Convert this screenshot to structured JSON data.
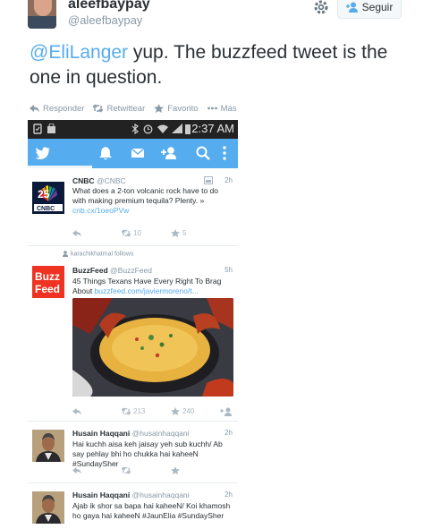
{
  "profile": {
    "name": "aleefbaypay",
    "handle": "@aleefbaypay",
    "follow_label": "Seguir"
  },
  "tweet": {
    "mention": "@EliLanger",
    "text": " yup. The buzzfeed tweet is the one in question."
  },
  "actions": {
    "reply": "Responder",
    "retweet": "Retwittear",
    "favorite": "Favorito",
    "more": "Más"
  },
  "phone": {
    "time": "2:37 AM",
    "feed": [
      {
        "name": "CNBC",
        "handle": "@CNBC",
        "time": "2h",
        "text": "What does a 2-ton volcanic rock have to do with making premium tequila? Plenty. » ",
        "link": "cnb.cx/1oeoPVw",
        "retweets": "10",
        "favorites": "5"
      },
      {
        "context": "karachikhatmal follows",
        "name": "BuzzFeed",
        "handle": "@BuzzFeed",
        "time": "5h",
        "text": "45 Things Texans Have Every Right To Brag About ",
        "link": "buzzfeed.com/javiermoreno/t...",
        "retweets": "213",
        "favorites": "240"
      },
      {
        "name": "Husain Haqqani",
        "handle": "@husainhaqqani",
        "time": "2h",
        "text": "Hai kuchh aisa keh jaisay yeh sub kuchh/ Ab say pehlay bhi ho chukka hai kaheeN #SundaySher"
      },
      {
        "name": "Husain Haqqani",
        "handle": "@husainhaqqani",
        "time": "2h",
        "text": "Ajab ik shor sa bapa hai kaheeN/ Koi khamosh ho gaya hai kaheeN #JaunElia #SundaySher"
      }
    ]
  },
  "colors": {
    "twitter_blue": "#55acee",
    "buzzfeed_red": "#ee3322",
    "text": "#292f33",
    "muted": "#8899a6"
  }
}
